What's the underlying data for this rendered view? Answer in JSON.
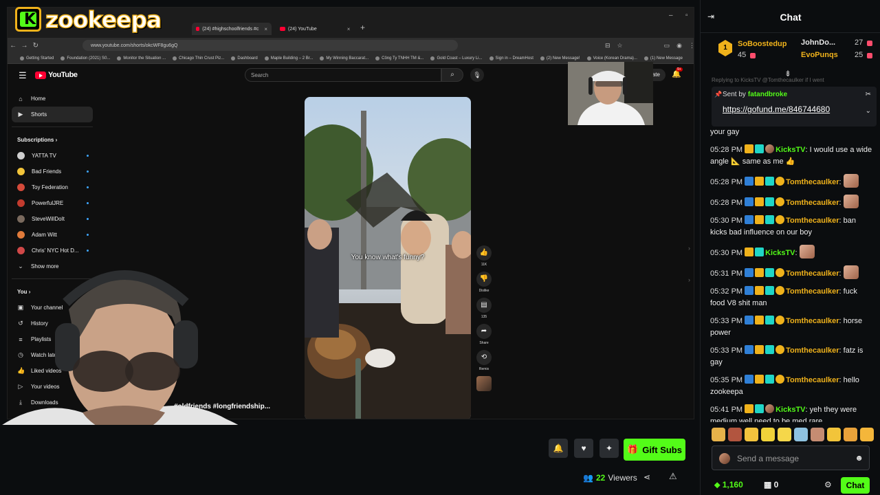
{
  "brand": {
    "logo_text": "zookeepa",
    "logo_letter": "K"
  },
  "browser": {
    "tabs": [
      {
        "label": "(24) #highschoolfriends #c"
      },
      {
        "label": "(24) YouTube"
      }
    ],
    "tab_close": "×",
    "new_tab": "+",
    "url": "www.youtube.com/shorts/okcWF8gu6gQ",
    "bookmarks": [
      "Getting Started",
      "Foundation (2021) S0...",
      "Monitor the Situation ...",
      "Chicago Thin Crust Piz...",
      "Dashboard",
      "Maple Building – 2 Br...",
      "My Winning Baccarat...",
      "Công Ty TNHH TM &...",
      "Gold Coast – Luxury Li...",
      "Sign in – DreamHost",
      "(2) New Message!",
      "Voice (Korean Drama)...",
      "(1) New Message"
    ]
  },
  "youtube": {
    "logo": "YouTube",
    "search_placeholder": "Search",
    "create_label": "Create",
    "notif_count": "9+",
    "sidebar": {
      "main": [
        {
          "label": "Home",
          "icon": "home-icon"
        },
        {
          "label": "Shorts",
          "icon": "shorts-icon"
        }
      ],
      "subscriptions_heading": "Subscriptions",
      "subscriptions": [
        {
          "label": "YATTA TV",
          "color": "#cfcfcf"
        },
        {
          "label": "Bad Friends",
          "color": "#f2c43a"
        },
        {
          "label": "Toy Federation",
          "color": "#d44a3a"
        },
        {
          "label": "PowerfulJRE",
          "color": "#c23b2e"
        },
        {
          "label": "SteveWillDoIt",
          "color": "#7a6a5e"
        },
        {
          "label": "Adam Witt",
          "color": "#e07a3a"
        },
        {
          "label": "Chris' NYC Hot D...",
          "color": "#d04848"
        }
      ],
      "show_more": "Show more",
      "you_heading": "You",
      "you_items": [
        {
          "label": "Your channel",
          "icon": "channel-icon"
        },
        {
          "label": "History",
          "icon": "history-icon"
        },
        {
          "label": "Playlists",
          "icon": "playlists-icon"
        },
        {
          "label": "Watch later",
          "icon": "watch-later-icon"
        },
        {
          "label": "Liked videos",
          "icon": "thumbs-up-icon"
        },
        {
          "label": "Your videos",
          "icon": "your-videos-icon"
        },
        {
          "label": "Downloads",
          "icon": "download-icon"
        }
      ]
    },
    "short": {
      "caption": "You know what's funny?",
      "hashtags": "#oldfriends #longfriendship..."
    },
    "actions": {
      "likes": "11K",
      "dislike": "Dislike",
      "comments": "135",
      "share": "Share",
      "remix": "Remix"
    }
  },
  "stream": {
    "gift_subs": "Gift Subs",
    "viewers_count": "22",
    "viewers_label": "Viewers"
  },
  "chat": {
    "title": "Chat",
    "leaderboard": [
      {
        "name": "SoBoostedup",
        "count": "45",
        "color": "#f0b21b"
      },
      {
        "name": "JohnDo...",
        "count": "27",
        "color": "#e6e6e6"
      },
      {
        "name": "EvoPunqs",
        "count": "25",
        "color": "#f0b21b"
      }
    ],
    "leader_rank": "1",
    "pinned": {
      "sent_by": "Sent by",
      "user": "fatandbroke",
      "link": "https://gofund.me/846744680"
    },
    "reply_ghost": "Replying to KicksTV @Tomthecaulker if I went",
    "messages": [
      {
        "time": "",
        "user": "",
        "text": "your gay"
      },
      {
        "time": "05:28 PM",
        "user": "KicksTV",
        "text": ": I would use a wide angle 📐 same as me 👍"
      },
      {
        "time": "05:28 PM",
        "user": "Tomthecaulker",
        "text": ":",
        "emote": true
      },
      {
        "time": "05:28 PM",
        "user": "Tomthecaulker",
        "text": ":",
        "emote": true
      },
      {
        "time": "05:30 PM",
        "user": "Tomthecaulker",
        "text": ": ban kicks bad influence on our boy"
      },
      {
        "time": "05:30 PM",
        "user": "KicksTV",
        "text": ":",
        "emote": true
      },
      {
        "time": "05:31 PM",
        "user": "Tomthecaulker",
        "text": ":",
        "emote": true
      },
      {
        "time": "05:32 PM",
        "user": "Tomthecaulker",
        "text": ": fuck food V8 shit man"
      },
      {
        "time": "05:33 PM",
        "user": "Tomthecaulker",
        "text": ": horse power"
      },
      {
        "time": "05:33 PM",
        "user": "Tomthecaulker",
        "text": ": fatz is gay"
      },
      {
        "time": "05:35 PM",
        "user": "Tomthecaulker",
        "text": ": hello zookeepa"
      },
      {
        "time": "05:41 PM",
        "user": "KicksTV",
        "text": ": yeh they were medium well need to be med rare"
      }
    ],
    "input_placeholder": "Send a message",
    "points": "1,160",
    "box_count": "0",
    "chat_button": "Chat"
  }
}
